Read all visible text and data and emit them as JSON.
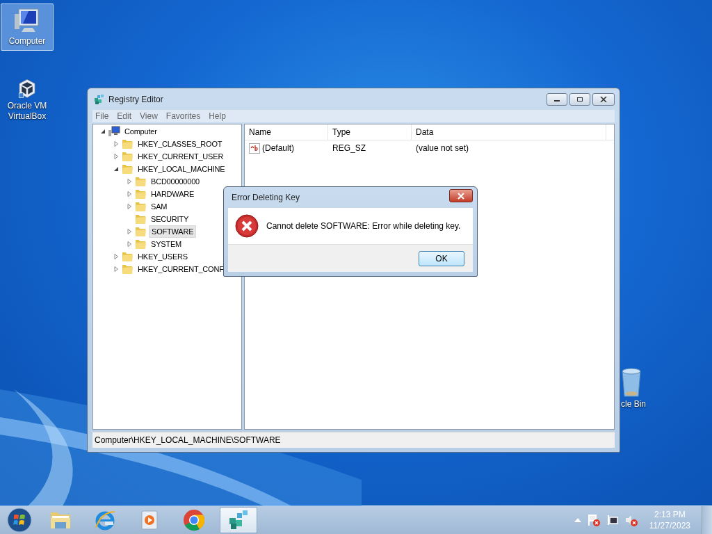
{
  "desktop_icons": [
    {
      "kind": "computer",
      "label": "Computer",
      "selected": true
    },
    {
      "kind": "virtualbox",
      "label": "Oracle VM VirtualBox",
      "selected": false
    },
    {
      "kind": "recycle-bin",
      "label": "cle Bin",
      "selected": false
    }
  ],
  "registry_editor": {
    "title": "Registry Editor",
    "menu": [
      "File",
      "Edit",
      "View",
      "Favorites",
      "Help"
    ],
    "tree": [
      {
        "label": "Computer",
        "kind": "computer",
        "expanded": true,
        "selected": false,
        "children": [
          {
            "label": "HKEY_CLASSES_ROOT",
            "kind": "folder",
            "expanded": false,
            "selected": false
          },
          {
            "label": "HKEY_CURRENT_USER",
            "kind": "folder",
            "expanded": false,
            "selected": false
          },
          {
            "label": "HKEY_LOCAL_MACHINE",
            "kind": "folder",
            "expanded": true,
            "selected": false,
            "children": [
              {
                "label": "BCD00000000",
                "kind": "folder",
                "expanded": false,
                "selected": false
              },
              {
                "label": "HARDWARE",
                "kind": "folder",
                "expanded": false,
                "selected": false
              },
              {
                "label": "SAM",
                "kind": "folder",
                "expanded": false,
                "selected": false
              },
              {
                "label": "SECURITY",
                "kind": "folder",
                "selected": false
              },
              {
                "label": "SOFTWARE",
                "kind": "folder",
                "expanded": false,
                "selected": true
              },
              {
                "label": "SYSTEM",
                "kind": "folder",
                "expanded": false,
                "selected": false
              }
            ]
          },
          {
            "label": "HKEY_USERS",
            "kind": "folder",
            "expanded": false,
            "selected": false
          },
          {
            "label": "HKEY_CURRENT_CONF",
            "kind": "folder",
            "expanded": false,
            "selected": false
          }
        ]
      }
    ],
    "columns": [
      "Name",
      "Type",
      "Data"
    ],
    "rows": [
      {
        "name": "(Default)",
        "type": "REG_SZ",
        "data": "(value not set)"
      }
    ],
    "status_bar": "Computer\\HKEY_LOCAL_MACHINE\\SOFTWARE"
  },
  "dialog": {
    "title": "Error Deleting Key",
    "message": "Cannot delete SOFTWARE:  Error while deleting key.",
    "button": "OK"
  },
  "taskbar": {
    "items": [
      {
        "kind": "start",
        "selected": false
      },
      {
        "kind": "explorer",
        "selected": false
      },
      {
        "kind": "ie",
        "selected": false
      },
      {
        "kind": "media",
        "selected": false
      },
      {
        "kind": "chrome",
        "selected": false
      },
      {
        "kind": "regedit",
        "selected": true
      }
    ],
    "tray": [
      {
        "kind": "caret"
      },
      {
        "kind": "flag"
      },
      {
        "kind": "network"
      },
      {
        "kind": "sound"
      }
    ],
    "time": "2:13 PM",
    "date": "11/27/2023"
  }
}
